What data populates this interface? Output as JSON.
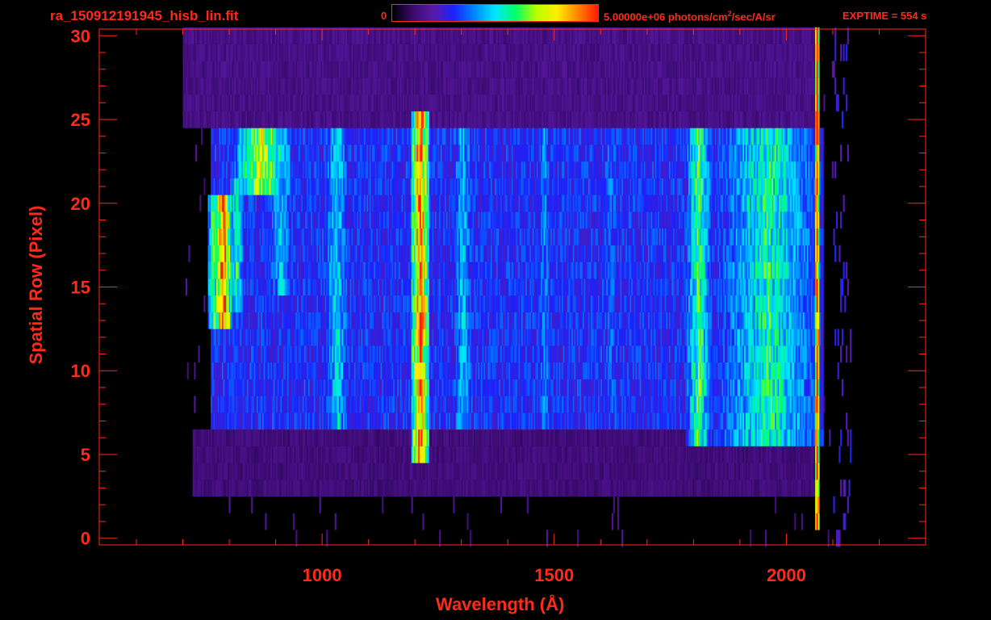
{
  "header": {
    "filename": "ra_150912191945_hisb_lin.fit",
    "colorbar_min": "0",
    "colorbar_max": "5.00000e+06 photons/cm",
    "colorbar_max_sup": "2",
    "colorbar_max_tail": "/sec/A/sr",
    "exptime": "EXPTIME = 554 s"
  },
  "colors": {
    "axis": "#ff2a1a",
    "background": "#000000"
  },
  "chart_data": {
    "type": "heatmap",
    "xlabel": "Wavelength (Å)",
    "ylabel": "Spatial Row (Pixel)",
    "xlim": [
      520,
      2300
    ],
    "ylim": [
      -0.4,
      30.4
    ],
    "x_ticks": [
      1000,
      1500,
      2000
    ],
    "y_ticks": [
      0,
      5,
      10,
      15,
      20,
      25,
      30
    ],
    "x_range": [
      700,
      2100
    ],
    "rows": 31,
    "colormap": [
      "#000000",
      "#3a0a6e",
      "#5a1aa8",
      "#1a22ff",
      "#0088ff",
      "#00e6ff",
      "#00ff66",
      "#b8ff00",
      "#ffee00",
      "#ff8800",
      "#ff1a00"
    ],
    "background_regions": [
      {
        "rows": [
          7,
          24
        ],
        "x": [
          760,
          2060
        ],
        "level": 0.3
      },
      {
        "rows": [
          25,
          30
        ],
        "x": [
          700,
          2060
        ],
        "level": 0.14
      },
      {
        "rows": [
          3,
          6
        ],
        "x": [
          720,
          2060
        ],
        "level": 0.12
      }
    ],
    "features": [
      {
        "x": 1210,
        "width": 20,
        "rows": [
          5,
          25
        ],
        "level": 0.92
      },
      {
        "x": 2065,
        "width": 6,
        "rows": [
          1,
          30
        ],
        "level": 1.0
      },
      {
        "x": 1810,
        "width": 28,
        "rows": [
          6,
          24
        ],
        "level": 0.62
      },
      {
        "x": 1960,
        "width": 120,
        "rows": [
          6,
          24
        ],
        "level": 0.56
      },
      {
        "x": 1030,
        "width": 30,
        "rows": [
          7,
          24
        ],
        "level": 0.5
      },
      {
        "x": 1302,
        "width": 30,
        "rows": [
          7,
          24
        ],
        "level": 0.45
      },
      {
        "x": 1478,
        "width": 22,
        "rows": [
          7,
          24
        ],
        "level": 0.4
      },
      {
        "x": 1620,
        "width": 40,
        "rows": [
          7,
          24
        ],
        "level": 0.36
      },
      {
        "x": 785,
        "width": 18,
        "rows": [
          13,
          20
        ],
        "level": 0.96
      },
      {
        "x": 765,
        "width": 14,
        "rows": [
          13,
          20
        ],
        "level": 0.62
      },
      {
        "x": 815,
        "width": 16,
        "rows": [
          14,
          21
        ],
        "level": 0.58
      },
      {
        "x": 870,
        "width": 60,
        "rows": [
          21,
          24
        ],
        "level": 0.72
      },
      {
        "x": 910,
        "width": 30,
        "rows": [
          15,
          22
        ],
        "level": 0.48
      }
    ]
  }
}
